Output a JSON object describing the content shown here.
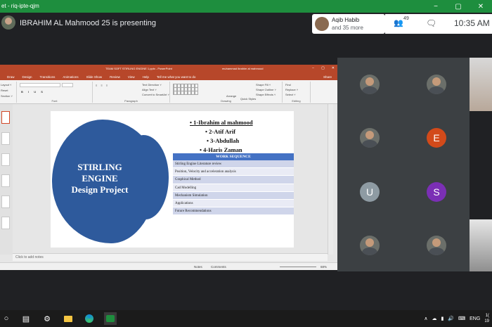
{
  "browser": {
    "url_fragment": "et - riq-ipte-qjm",
    "controls": [
      "−",
      "▢",
      "✕"
    ]
  },
  "meet": {
    "presenter_text": "IBRAHIM AL Mahmood 25 is presenting",
    "join_name": "Aqib Habib",
    "join_more": "and 35 more",
    "participants_count": "49",
    "people_icon": "people-icon",
    "chat_icon": "chat-icon",
    "time": "10:35 AM",
    "tiles": [
      {
        "type": "photo"
      },
      {
        "type": "photo"
      },
      {
        "type": "photo"
      },
      {
        "type": "letter",
        "letter": "E",
        "color": "#d24a1a"
      },
      {
        "type": "letter",
        "letter": "U",
        "color": "#8e9ba3"
      },
      {
        "type": "letter",
        "letter": "S",
        "color": "#7b2fb5"
      },
      {
        "type": "photo"
      },
      {
        "type": "photo"
      }
    ]
  },
  "ppt": {
    "doc_title": "TEAM SOFT STIRLING ENGINE 1.pptx - PowerPoint",
    "user_name": "muhammad ibrahim al mahmood",
    "window_controls": [
      "−",
      "▢",
      "✕"
    ],
    "tabs": [
      "Draw",
      "Design",
      "Transitions",
      "Animations",
      "Slide Show",
      "Review",
      "View",
      "Help",
      "Tell me what you want to do",
      "Share"
    ],
    "ribbon": {
      "layout": "Layout ˅",
      "reset": "Reset",
      "section": "Section ˅",
      "font_group": "Font",
      "paragraph_group": "Paragraph",
      "text_direction": "Text Direction ˅",
      "align_text": "Align Text ˅",
      "convert_smartart": "Convert to SmartArt ˅",
      "drawing_group": "Drawing",
      "arrange": "Arrange",
      "quick_styles": "Quick Styles",
      "shape_fill": "Shape Fill ˅",
      "shape_outline": "Shape Outline ˅",
      "shape_effects": "Shape Effects ˅",
      "find": "Find",
      "replace": "Replace ˅",
      "select": "Select ˅",
      "editing_group": "Editing"
    },
    "notes_placeholder": "Click to add notes",
    "status": {
      "notes": "Notes",
      "comments": "Comments",
      "zoom": "68%"
    },
    "slide": {
      "title_lines": [
        "STIRLING",
        "ENGINE",
        "Design Project"
      ],
      "members": [
        "1-Ibrahim al mahmood",
        "2-Atif Arif",
        "3-Abdullah",
        "4-Haris Zaman"
      ],
      "work_sequence_header": "WORK SEQUENCE",
      "work_sequence": [
        "Stirling Engine Literature review",
        "Position, Velocity and acceleration analysis",
        "Graphical Method",
        "Cad Modelling",
        "Mechanism Simulation",
        "Applications",
        "Future Recommendations"
      ],
      "accent_color": "#2e5a9c",
      "table_header_color": "#4472c4"
    }
  },
  "taskbar": {
    "icons": [
      "start-icon",
      "search-icon",
      "task-view-icon",
      "settings-icon",
      "file-explorer-icon",
      "edge-icon",
      "meet-icon"
    ],
    "lang": "ENG",
    "clock_line1": "1(",
    "clock_line2": "19"
  }
}
